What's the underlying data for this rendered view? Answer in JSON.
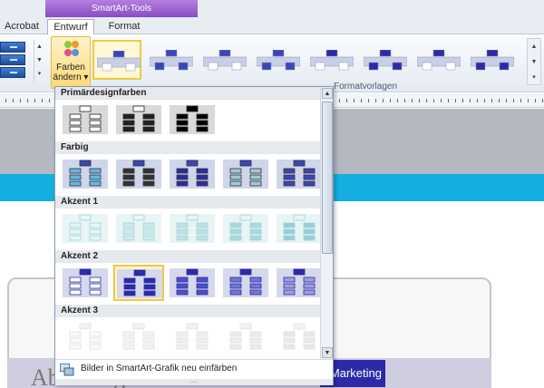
{
  "ribbon": {
    "context_header": "SmartArt-Tools",
    "tabs": [
      {
        "label": "Acrobat"
      },
      {
        "label": "Entwurf"
      },
      {
        "label": "Format"
      }
    ],
    "change_colors_button": {
      "line1": "Farben",
      "line2": "ändern"
    },
    "group_label": "Formatvorlagen"
  },
  "dropdown": {
    "sections": [
      {
        "title": "Primärdesignfarben"
      },
      {
        "title": "Farbig"
      },
      {
        "title": "Akzent 1"
      },
      {
        "title": "Akzent 2"
      },
      {
        "title": "Akzent 3"
      }
    ],
    "recolor_pictures_label": "Bilder in SmartArt-Grafik neu einfärben",
    "selected_item": {
      "section": "Akzent 2",
      "index": 2
    }
  },
  "slide": {
    "title_partial": "Abteilung",
    "shape_text_partial": "Marketing"
  },
  "colors": {
    "accent_blue": "#2c2aa8",
    "slide_cyan": "#14aee0",
    "ribbon_context": "#8a4cc2",
    "selection_gold": "#f2c842"
  }
}
